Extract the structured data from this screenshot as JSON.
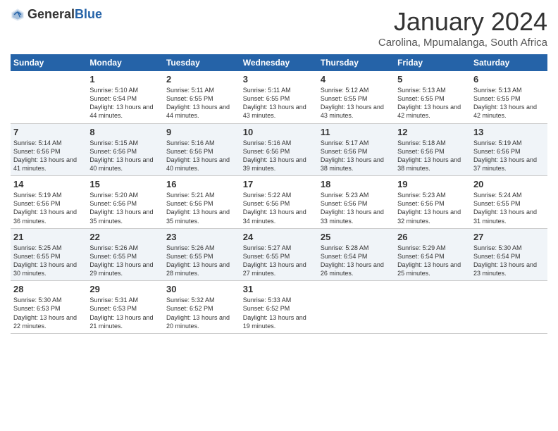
{
  "header": {
    "logo_general": "General",
    "logo_blue": "Blue",
    "title": "January 2024",
    "subtitle": "Carolina, Mpumalanga, South Africa"
  },
  "weekdays": [
    "Sunday",
    "Monday",
    "Tuesday",
    "Wednesday",
    "Thursday",
    "Friday",
    "Saturday"
  ],
  "weeks": [
    [
      {
        "day": "",
        "sunrise": "",
        "sunset": "",
        "daylight": ""
      },
      {
        "day": "1",
        "sunrise": "Sunrise: 5:10 AM",
        "sunset": "Sunset: 6:54 PM",
        "daylight": "Daylight: 13 hours and 44 minutes."
      },
      {
        "day": "2",
        "sunrise": "Sunrise: 5:11 AM",
        "sunset": "Sunset: 6:55 PM",
        "daylight": "Daylight: 13 hours and 44 minutes."
      },
      {
        "day": "3",
        "sunrise": "Sunrise: 5:11 AM",
        "sunset": "Sunset: 6:55 PM",
        "daylight": "Daylight: 13 hours and 43 minutes."
      },
      {
        "day": "4",
        "sunrise": "Sunrise: 5:12 AM",
        "sunset": "Sunset: 6:55 PM",
        "daylight": "Daylight: 13 hours and 43 minutes."
      },
      {
        "day": "5",
        "sunrise": "Sunrise: 5:13 AM",
        "sunset": "Sunset: 6:55 PM",
        "daylight": "Daylight: 13 hours and 42 minutes."
      },
      {
        "day": "6",
        "sunrise": "Sunrise: 5:13 AM",
        "sunset": "Sunset: 6:55 PM",
        "daylight": "Daylight: 13 hours and 42 minutes."
      }
    ],
    [
      {
        "day": "7",
        "sunrise": "Sunrise: 5:14 AM",
        "sunset": "Sunset: 6:56 PM",
        "daylight": "Daylight: 13 hours and 41 minutes."
      },
      {
        "day": "8",
        "sunrise": "Sunrise: 5:15 AM",
        "sunset": "Sunset: 6:56 PM",
        "daylight": "Daylight: 13 hours and 40 minutes."
      },
      {
        "day": "9",
        "sunrise": "Sunrise: 5:16 AM",
        "sunset": "Sunset: 6:56 PM",
        "daylight": "Daylight: 13 hours and 40 minutes."
      },
      {
        "day": "10",
        "sunrise": "Sunrise: 5:16 AM",
        "sunset": "Sunset: 6:56 PM",
        "daylight": "Daylight: 13 hours and 39 minutes."
      },
      {
        "day": "11",
        "sunrise": "Sunrise: 5:17 AM",
        "sunset": "Sunset: 6:56 PM",
        "daylight": "Daylight: 13 hours and 38 minutes."
      },
      {
        "day": "12",
        "sunrise": "Sunrise: 5:18 AM",
        "sunset": "Sunset: 6:56 PM",
        "daylight": "Daylight: 13 hours and 38 minutes."
      },
      {
        "day": "13",
        "sunrise": "Sunrise: 5:19 AM",
        "sunset": "Sunset: 6:56 PM",
        "daylight": "Daylight: 13 hours and 37 minutes."
      }
    ],
    [
      {
        "day": "14",
        "sunrise": "Sunrise: 5:19 AM",
        "sunset": "Sunset: 6:56 PM",
        "daylight": "Daylight: 13 hours and 36 minutes."
      },
      {
        "day": "15",
        "sunrise": "Sunrise: 5:20 AM",
        "sunset": "Sunset: 6:56 PM",
        "daylight": "Daylight: 13 hours and 35 minutes."
      },
      {
        "day": "16",
        "sunrise": "Sunrise: 5:21 AM",
        "sunset": "Sunset: 6:56 PM",
        "daylight": "Daylight: 13 hours and 35 minutes."
      },
      {
        "day": "17",
        "sunrise": "Sunrise: 5:22 AM",
        "sunset": "Sunset: 6:56 PM",
        "daylight": "Daylight: 13 hours and 34 minutes."
      },
      {
        "day": "18",
        "sunrise": "Sunrise: 5:23 AM",
        "sunset": "Sunset: 6:56 PM",
        "daylight": "Daylight: 13 hours and 33 minutes."
      },
      {
        "day": "19",
        "sunrise": "Sunrise: 5:23 AM",
        "sunset": "Sunset: 6:56 PM",
        "daylight": "Daylight: 13 hours and 32 minutes."
      },
      {
        "day": "20",
        "sunrise": "Sunrise: 5:24 AM",
        "sunset": "Sunset: 6:55 PM",
        "daylight": "Daylight: 13 hours and 31 minutes."
      }
    ],
    [
      {
        "day": "21",
        "sunrise": "Sunrise: 5:25 AM",
        "sunset": "Sunset: 6:55 PM",
        "daylight": "Daylight: 13 hours and 30 minutes."
      },
      {
        "day": "22",
        "sunrise": "Sunrise: 5:26 AM",
        "sunset": "Sunset: 6:55 PM",
        "daylight": "Daylight: 13 hours and 29 minutes."
      },
      {
        "day": "23",
        "sunrise": "Sunrise: 5:26 AM",
        "sunset": "Sunset: 6:55 PM",
        "daylight": "Daylight: 13 hours and 28 minutes."
      },
      {
        "day": "24",
        "sunrise": "Sunrise: 5:27 AM",
        "sunset": "Sunset: 6:55 PM",
        "daylight": "Daylight: 13 hours and 27 minutes."
      },
      {
        "day": "25",
        "sunrise": "Sunrise: 5:28 AM",
        "sunset": "Sunset: 6:54 PM",
        "daylight": "Daylight: 13 hours and 26 minutes."
      },
      {
        "day": "26",
        "sunrise": "Sunrise: 5:29 AM",
        "sunset": "Sunset: 6:54 PM",
        "daylight": "Daylight: 13 hours and 25 minutes."
      },
      {
        "day": "27",
        "sunrise": "Sunrise: 5:30 AM",
        "sunset": "Sunset: 6:54 PM",
        "daylight": "Daylight: 13 hours and 23 minutes."
      }
    ],
    [
      {
        "day": "28",
        "sunrise": "Sunrise: 5:30 AM",
        "sunset": "Sunset: 6:53 PM",
        "daylight": "Daylight: 13 hours and 22 minutes."
      },
      {
        "day": "29",
        "sunrise": "Sunrise: 5:31 AM",
        "sunset": "Sunset: 6:53 PM",
        "daylight": "Daylight: 13 hours and 21 minutes."
      },
      {
        "day": "30",
        "sunrise": "Sunrise: 5:32 AM",
        "sunset": "Sunset: 6:52 PM",
        "daylight": "Daylight: 13 hours and 20 minutes."
      },
      {
        "day": "31",
        "sunrise": "Sunrise: 5:33 AM",
        "sunset": "Sunset: 6:52 PM",
        "daylight": "Daylight: 13 hours and 19 minutes."
      },
      {
        "day": "",
        "sunrise": "",
        "sunset": "",
        "daylight": ""
      },
      {
        "day": "",
        "sunrise": "",
        "sunset": "",
        "daylight": ""
      },
      {
        "day": "",
        "sunrise": "",
        "sunset": "",
        "daylight": ""
      }
    ]
  ]
}
